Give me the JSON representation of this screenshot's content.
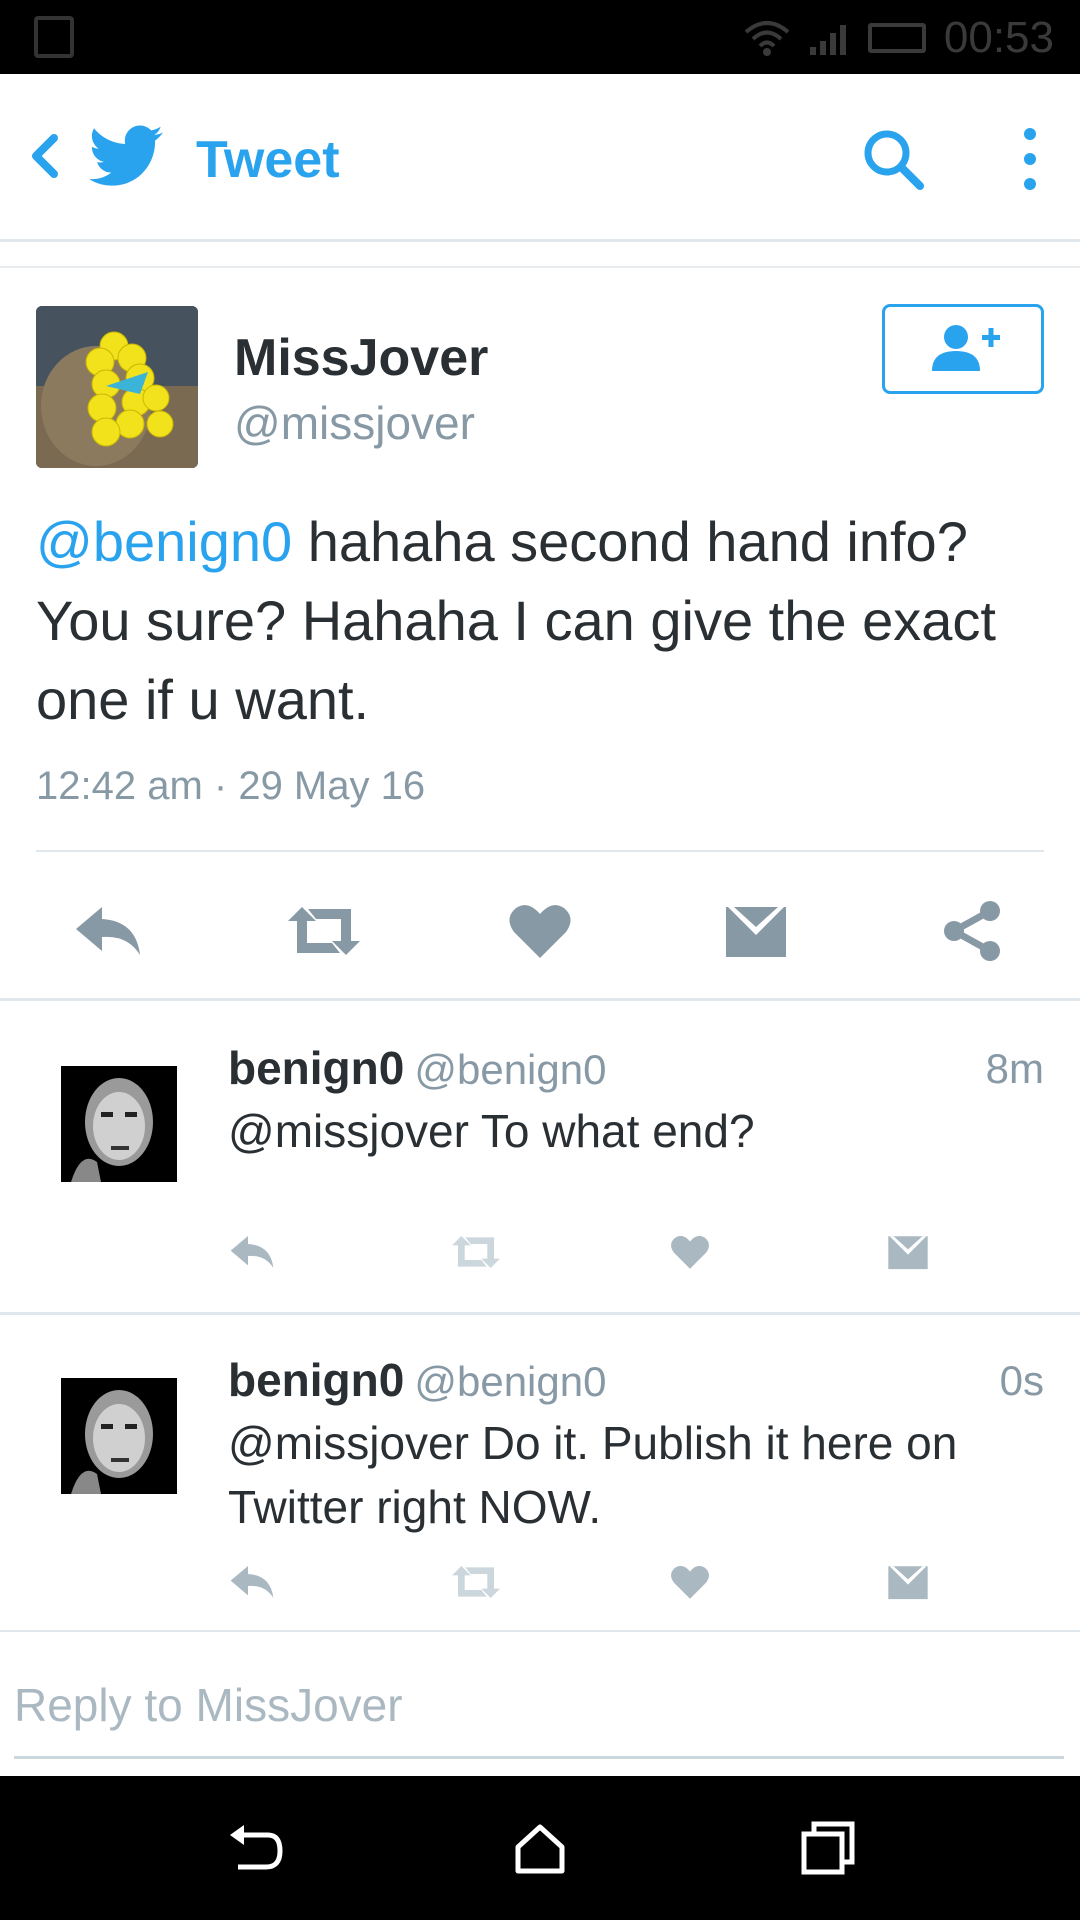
{
  "status_bar": {
    "time": "00:53"
  },
  "app_bar": {
    "title": "Tweet"
  },
  "tweet": {
    "author_name": "MissJover",
    "author_handle": "@missjover",
    "mention": "@benign0",
    "text": " hahaha second hand info? You sure? Hahaha I can give the exact one if u want.",
    "timestamp": "12:42 am · 29 May 16"
  },
  "replies": [
    {
      "name": "benign0",
      "handle": "@benign0",
      "time": "8m",
      "text": "@missjover To what end?"
    },
    {
      "name": "benign0",
      "handle": "@benign0",
      "time": "0s",
      "text": "@missjover Do it. Publish it here on Twitter right NOW."
    }
  ],
  "reply_box": {
    "placeholder": "Reply to MissJover"
  },
  "colors": {
    "accent": "#2aa3ef",
    "secondary_text": "#8899a6",
    "icon_gray": "#8899a6",
    "icon_light": "#aab8c2"
  },
  "icons": {
    "back": "chevron-left-icon",
    "logo": "twitter-bird-icon",
    "search": "search-icon",
    "more": "more-vertical-icon",
    "follow": "follow-user-icon",
    "reply": "reply-icon",
    "retweet": "retweet-icon",
    "like": "heart-icon",
    "dm": "envelope-icon",
    "share": "share-icon"
  }
}
